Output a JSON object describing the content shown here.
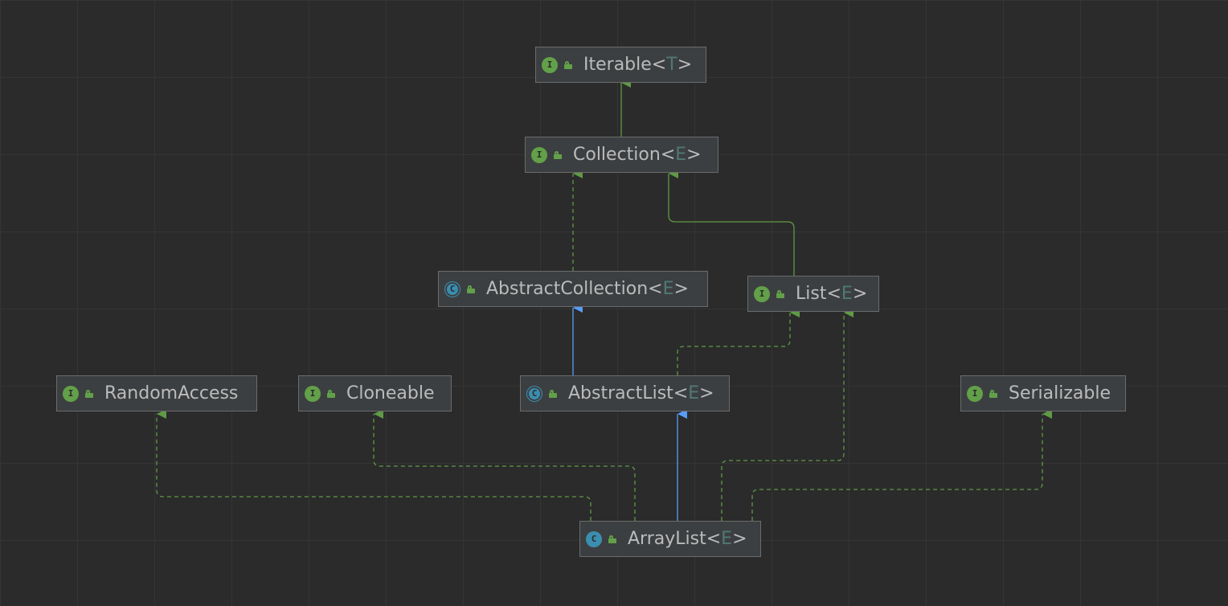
{
  "diagram": {
    "nodes": [
      {
        "id": "iterable",
        "kind": "interface",
        "badge": "I",
        "name": "Iterable",
        "type_param": "T"
      },
      {
        "id": "collection",
        "kind": "interface",
        "badge": "I",
        "name": "Collection",
        "type_param": "E"
      },
      {
        "id": "abstract_collection",
        "kind": "abstract",
        "badge": "C",
        "name": "AbstractCollection",
        "type_param": "E"
      },
      {
        "id": "list",
        "kind": "interface",
        "badge": "I",
        "name": "List",
        "type_param": "E"
      },
      {
        "id": "random_access",
        "kind": "interface",
        "badge": "I",
        "name": "RandomAccess",
        "type_param": null
      },
      {
        "id": "cloneable",
        "kind": "interface",
        "badge": "I",
        "name": "Cloneable",
        "type_param": null
      },
      {
        "id": "abstract_list",
        "kind": "abstract",
        "badge": "C",
        "name": "AbstractList",
        "type_param": "E"
      },
      {
        "id": "serializable",
        "kind": "interface",
        "badge": "I",
        "name": "Serializable",
        "type_param": null
      },
      {
        "id": "array_list",
        "kind": "class",
        "badge": "C",
        "name": "ArrayList",
        "type_param": "E"
      }
    ],
    "edges": [
      {
        "from": "collection",
        "to": "iterable",
        "relation": "extends-interface"
      },
      {
        "from": "abstract_collection",
        "to": "collection",
        "relation": "implements"
      },
      {
        "from": "list",
        "to": "collection",
        "relation": "extends-interface"
      },
      {
        "from": "abstract_list",
        "to": "abstract_collection",
        "relation": "extends-class"
      },
      {
        "from": "abstract_list",
        "to": "list",
        "relation": "implements"
      },
      {
        "from": "array_list",
        "to": "abstract_list",
        "relation": "extends-class"
      },
      {
        "from": "array_list",
        "to": "random_access",
        "relation": "implements"
      },
      {
        "from": "array_list",
        "to": "cloneable",
        "relation": "implements"
      },
      {
        "from": "array_list",
        "to": "list",
        "relation": "implements"
      },
      {
        "from": "array_list",
        "to": "serializable",
        "relation": "implements"
      }
    ],
    "colors": {
      "background": "#2b2b2b",
      "node_fill": "#3c3f41",
      "node_border": "#6b6b6b",
      "text": "#bbbbbb",
      "type_param": "#507874",
      "interface_badge": "#62a049",
      "class_badge": "#3b8eb0",
      "extends_class_edge": "#589df6",
      "interface_edge": "#5f9a45"
    },
    "icons": {
      "interface": "interface-icon",
      "class": "class-icon",
      "abstract": "abstract-class-icon",
      "visibility": "public-lock-icon"
    }
  }
}
